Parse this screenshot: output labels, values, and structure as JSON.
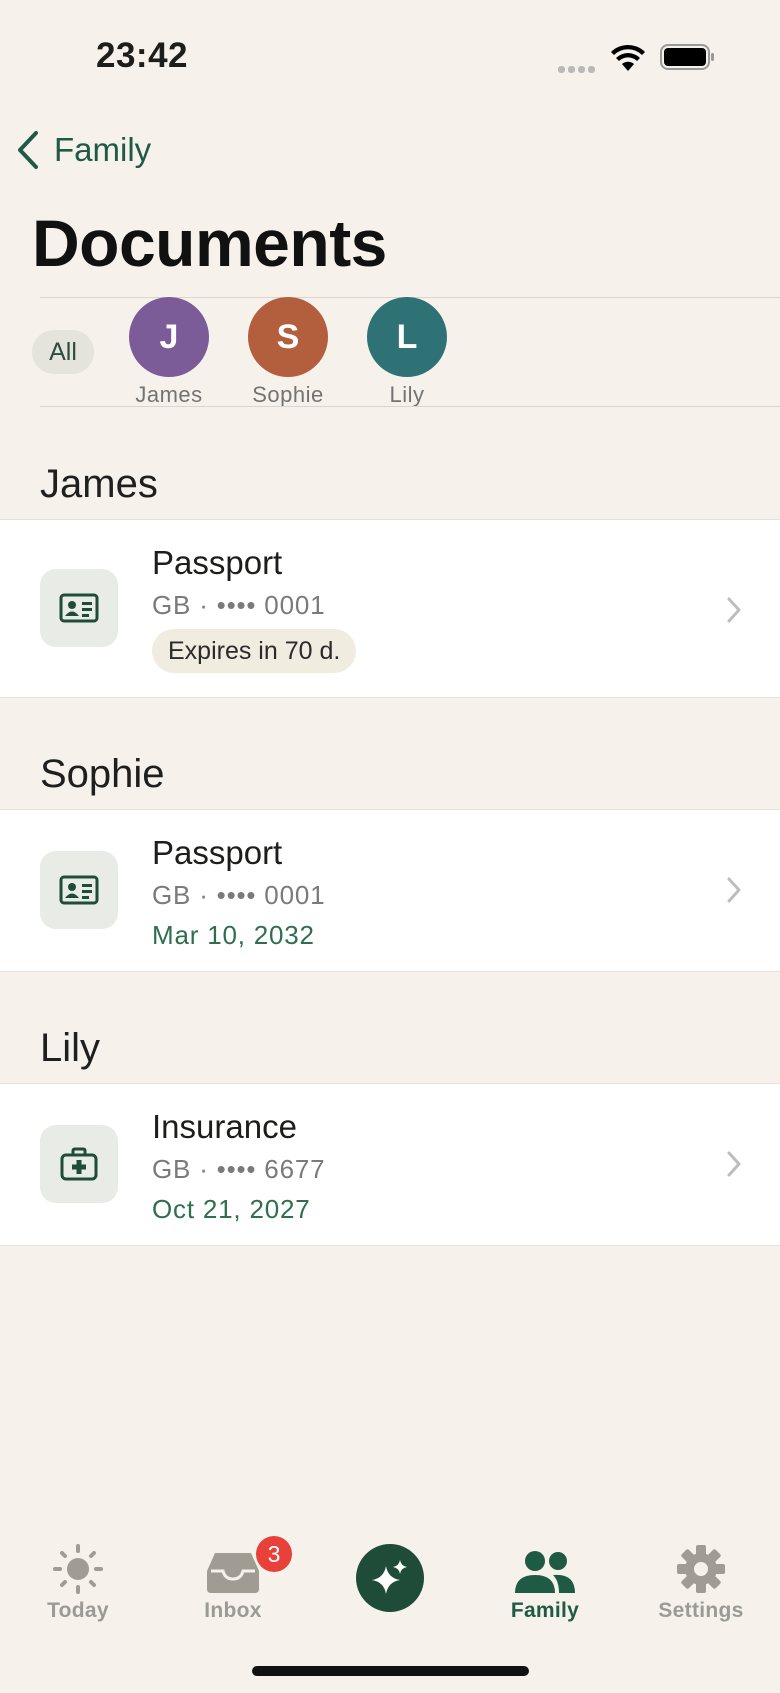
{
  "status_bar": {
    "time": "23:42"
  },
  "nav": {
    "back_label": "Family",
    "title": "Documents"
  },
  "filter": {
    "all_label": "All",
    "people": [
      {
        "initial": "J",
        "name": "James",
        "color": "#7b5b98"
      },
      {
        "initial": "S",
        "name": "Sophie",
        "color": "#b35e3d"
      },
      {
        "initial": "L",
        "name": "Lily",
        "color": "#2e7276"
      }
    ]
  },
  "sections": [
    {
      "title": "James",
      "doc": {
        "title": "Passport",
        "sub": "GB · •••• 0001",
        "pill": "Expires in 70 d.",
        "icon": "id-card-icon"
      }
    },
    {
      "title": "Sophie",
      "doc": {
        "title": "Passport",
        "sub": "GB · •••• 0001",
        "date": "Mar 10, 2032",
        "icon": "id-card-icon"
      }
    },
    {
      "title": "Lily",
      "doc": {
        "title": "Insurance",
        "sub": "GB · •••• 6677",
        "date": "Oct 21, 2027",
        "icon": "medical-kit-icon"
      }
    }
  ],
  "tabbar": {
    "today": "Today",
    "inbox": "Inbox",
    "inbox_badge": "3",
    "family": "Family",
    "settings": "Settings"
  },
  "colors": {
    "accent": "#1f5a45",
    "background": "#f6f2eb",
    "badge": "#e8413a"
  }
}
